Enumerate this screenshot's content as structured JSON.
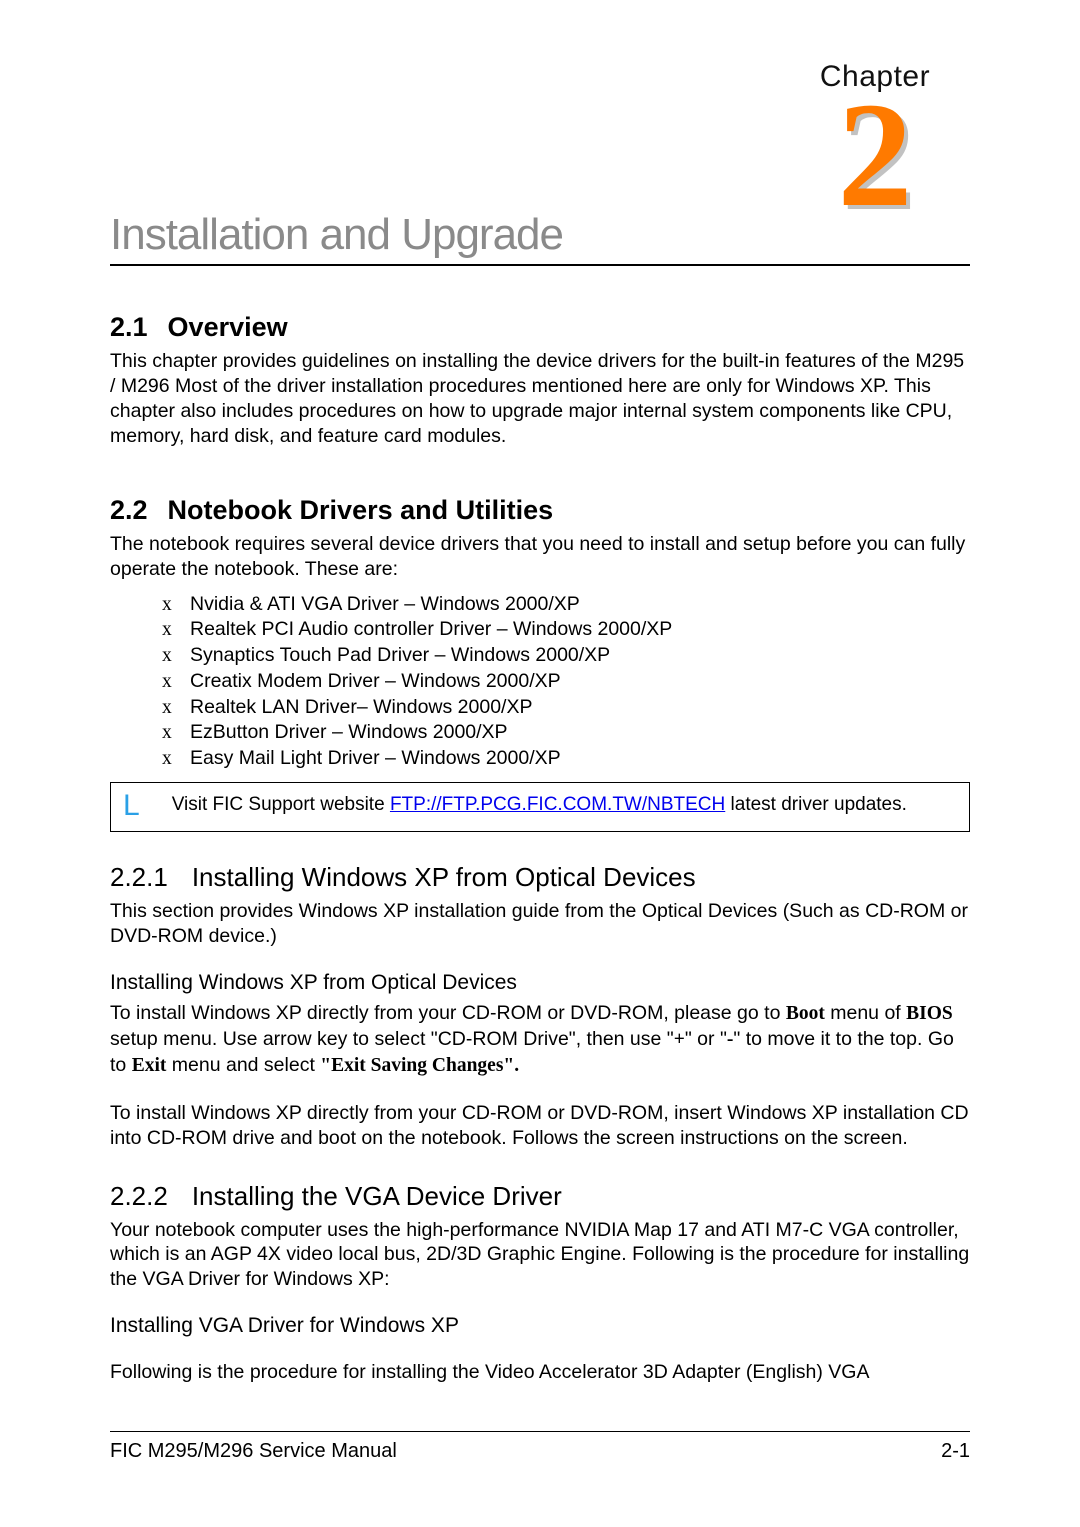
{
  "chapter": {
    "label": "Chapter",
    "number": "2"
  },
  "main_title": "Installation and Upgrade",
  "section_2_1": {
    "heading_num": "2.1",
    "heading_text": "Overview",
    "body": "This chapter provides guidelines on installing the device drivers for the built-in features of the M295 / M296 Most of the driver installation procedures mentioned here are only for Windows XP. This chapter also includes procedures on how to upgrade major internal system components like CPU, memory, hard disk, and feature card modules."
  },
  "section_2_2": {
    "heading_num": "2.2",
    "heading_text": "Notebook Drivers and Utilities",
    "intro": "The notebook requires several device drivers that you need to install and setup before you can fully operate the notebook. These are:",
    "drivers": [
      "Nvidia & ATI VGA Driver – Windows 2000/XP",
      "Realtek PCI Audio controller Driver – Windows 2000/XP",
      "Synaptics Touch Pad Driver – Windows 2000/XP",
      "Creatix Modem Driver – Windows 2000/XP",
      "Realtek LAN Driver– Windows 2000/XP",
      "EzButton Driver – Windows 2000/XP",
      "Easy Mail Light Driver – Windows 2000/XP"
    ],
    "note_icon": "L",
    "note_pre": "Visit FIC Support website ",
    "note_link_text": "FTP://FTP.PCG.FIC.COM.TW/NBTECH",
    "note_post": " latest driver updates."
  },
  "section_2_2_1": {
    "heading_num": "2.2.1",
    "heading_text": "Installing Windows XP from Optical Devices",
    "p1": "This section provides Windows XP installation guide from the Optical Devices (Such as CD-ROM or DVD-ROM device.)",
    "sub_heading": "Installing Windows XP from Optical Devices",
    "p2_a": "To install Windows XP directly from your CD-ROM or DVD-ROM, please go to ",
    "p2_boot": "Boot",
    "p2_b": " menu of ",
    "p2_bios": "BIOS",
    "p2_c": " setup menu. Use arrow key to select \"CD-ROM Drive\", then use \"",
    "p2_plus": "+",
    "p2_d": "\" or \"",
    "p2_minus": "-",
    "p2_e": "\" to move it to the top. Go to ",
    "p2_exit": "Exit",
    "p2_f": " menu and select ",
    "p2_exit_saving": "\"Exit Saving Changes\".",
    "p3": "To install Windows XP directly from your CD-ROM or DVD-ROM, insert Windows XP installation CD into CD-ROM drive and boot on the notebook. Follows the screen instructions on the screen."
  },
  "section_2_2_2": {
    "heading_num": "2.2.2",
    "heading_text": "Installing the VGA Device Driver",
    "p1": "Your notebook computer uses the high-performance NVIDIA Map 17 and ATI M7-C VGA controller, which is an AGP 4X video local bus, 2D/3D Graphic Engine. Following is the procedure for installing the VGA Driver for Windows XP:",
    "sub_heading": "Installing VGA Driver for Windows XP",
    "p2": "Following is the procedure for installing the Video Accelerator 3D Adapter (English) VGA"
  },
  "footer": {
    "left": "FIC M295/M296 Service Manual",
    "right": "2-1"
  }
}
